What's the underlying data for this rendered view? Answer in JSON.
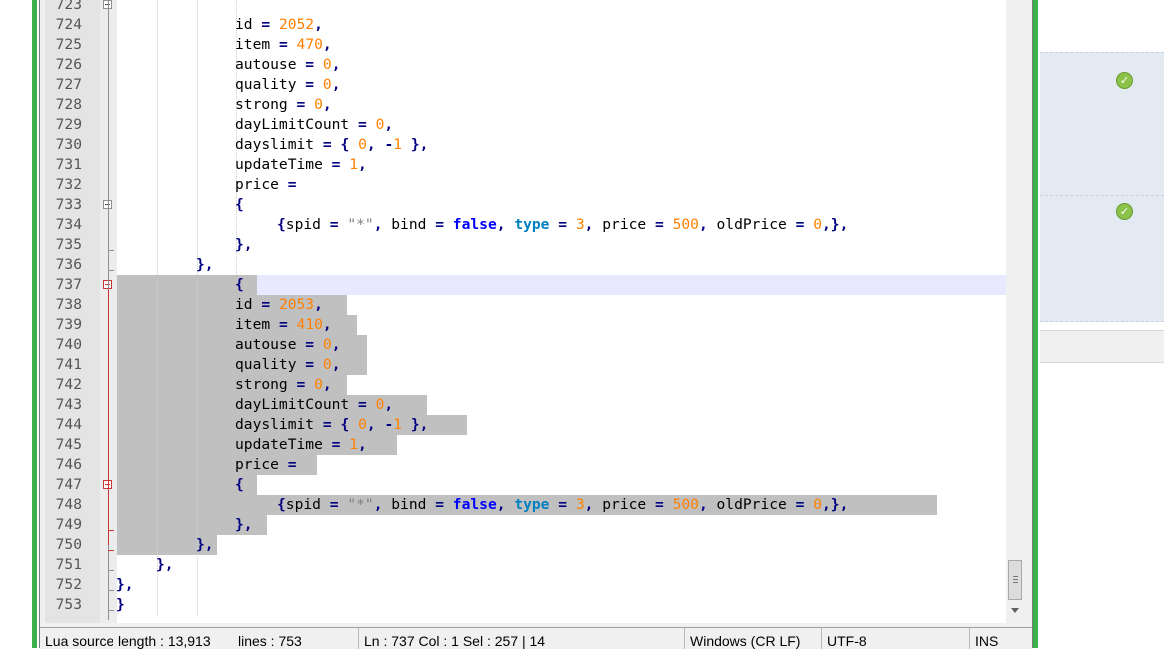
{
  "editor": {
    "lines": [
      {
        "n": "723",
        "parts": []
      },
      {
        "n": "724",
        "parts": [
          [
            "id ",
            ""
          ],
          [
            "=",
            "op"
          ],
          [
            " ",
            ""
          ],
          [
            "2052",
            "num"
          ],
          [
            ",",
            "op"
          ]
        ]
      },
      {
        "n": "725",
        "parts": [
          [
            "item ",
            ""
          ],
          [
            "=",
            "op"
          ],
          [
            " ",
            ""
          ],
          [
            "470",
            "num"
          ],
          [
            ",",
            "op"
          ]
        ]
      },
      {
        "n": "726",
        "parts": [
          [
            "autouse ",
            ""
          ],
          [
            "=",
            "op"
          ],
          [
            " ",
            ""
          ],
          [
            "0",
            "num"
          ],
          [
            ",",
            "op"
          ]
        ]
      },
      {
        "n": "727",
        "parts": [
          [
            "quality ",
            ""
          ],
          [
            "=",
            "op"
          ],
          [
            " ",
            ""
          ],
          [
            "0",
            "num"
          ],
          [
            ",",
            "op"
          ]
        ]
      },
      {
        "n": "728",
        "parts": [
          [
            "strong ",
            ""
          ],
          [
            "=",
            "op"
          ],
          [
            " ",
            ""
          ],
          [
            "0",
            "num"
          ],
          [
            ",",
            "op"
          ]
        ]
      },
      {
        "n": "729",
        "parts": [
          [
            "dayLimitCount ",
            ""
          ],
          [
            "=",
            "op"
          ],
          [
            " ",
            ""
          ],
          [
            "0",
            "num"
          ],
          [
            ",",
            "op"
          ]
        ]
      },
      {
        "n": "730",
        "parts": [
          [
            "dayslimit ",
            ""
          ],
          [
            "=",
            "op"
          ],
          [
            " ",
            ""
          ],
          [
            "{",
            "op"
          ],
          [
            " ",
            ""
          ],
          [
            "0",
            "num"
          ],
          [
            ",",
            "op"
          ],
          [
            " ",
            ""
          ],
          [
            "-",
            "op"
          ],
          [
            "1",
            "num"
          ],
          [
            " ",
            ""
          ],
          [
            "},",
            "op"
          ]
        ]
      },
      {
        "n": "731",
        "parts": [
          [
            "updateTime ",
            ""
          ],
          [
            "=",
            "op"
          ],
          [
            " ",
            ""
          ],
          [
            "1",
            "num"
          ],
          [
            ",",
            "op"
          ]
        ]
      },
      {
        "n": "732",
        "parts": [
          [
            "price ",
            ""
          ],
          [
            "=",
            "op"
          ]
        ]
      },
      {
        "n": "733",
        "parts": [
          [
            "{",
            "op"
          ]
        ]
      },
      {
        "n": "734",
        "parts": [
          [
            "{",
            "op"
          ],
          [
            "spid ",
            ""
          ],
          [
            "=",
            "op"
          ],
          [
            " ",
            ""
          ],
          [
            "\"*\"",
            "str"
          ],
          [
            ",",
            "op"
          ],
          [
            " bind ",
            ""
          ],
          [
            "=",
            "op"
          ],
          [
            " ",
            ""
          ],
          [
            "false",
            "kw"
          ],
          [
            ",",
            "op"
          ],
          [
            " ",
            ""
          ],
          [
            "type",
            "kw2"
          ],
          [
            " ",
            ""
          ],
          [
            "=",
            "op"
          ],
          [
            " ",
            ""
          ],
          [
            "3",
            "num"
          ],
          [
            ",",
            "op"
          ],
          [
            " price ",
            ""
          ],
          [
            "=",
            "op"
          ],
          [
            " ",
            ""
          ],
          [
            "500",
            "num"
          ],
          [
            ",",
            "op"
          ],
          [
            " oldPrice ",
            ""
          ],
          [
            "=",
            "op"
          ],
          [
            " ",
            ""
          ],
          [
            "0",
            "num"
          ],
          [
            ",},",
            "op"
          ]
        ]
      },
      {
        "n": "735",
        "parts": [
          [
            "},",
            "op"
          ]
        ]
      },
      {
        "n": "736",
        "parts": [
          [
            "},",
            "op"
          ]
        ]
      },
      {
        "n": "737",
        "parts": [
          [
            "{",
            "op"
          ]
        ]
      },
      {
        "n": "738",
        "parts": [
          [
            "id ",
            ""
          ],
          [
            "=",
            "op"
          ],
          [
            " ",
            ""
          ],
          [
            "2053",
            "num"
          ],
          [
            ",",
            "op"
          ]
        ]
      },
      {
        "n": "739",
        "parts": [
          [
            "item ",
            ""
          ],
          [
            "=",
            "op"
          ],
          [
            " ",
            ""
          ],
          [
            "410",
            "num"
          ],
          [
            ",",
            "op"
          ]
        ]
      },
      {
        "n": "740",
        "parts": [
          [
            "autouse ",
            ""
          ],
          [
            "=",
            "op"
          ],
          [
            " ",
            ""
          ],
          [
            "0",
            "num"
          ],
          [
            ",",
            "op"
          ]
        ]
      },
      {
        "n": "741",
        "parts": [
          [
            "quality ",
            ""
          ],
          [
            "=",
            "op"
          ],
          [
            " ",
            ""
          ],
          [
            "0",
            "num"
          ],
          [
            ",",
            "op"
          ]
        ]
      },
      {
        "n": "742",
        "parts": [
          [
            "strong ",
            ""
          ],
          [
            "=",
            "op"
          ],
          [
            " ",
            ""
          ],
          [
            "0",
            "num"
          ],
          [
            ",",
            "op"
          ]
        ]
      },
      {
        "n": "743",
        "parts": [
          [
            "dayLimitCount ",
            ""
          ],
          [
            "=",
            "op"
          ],
          [
            " ",
            ""
          ],
          [
            "0",
            "num"
          ],
          [
            ",",
            "op"
          ]
        ]
      },
      {
        "n": "744",
        "parts": [
          [
            "dayslimit ",
            ""
          ],
          [
            "=",
            "op"
          ],
          [
            " ",
            ""
          ],
          [
            "{",
            "op"
          ],
          [
            " ",
            ""
          ],
          [
            "0",
            "num"
          ],
          [
            ",",
            "op"
          ],
          [
            " ",
            ""
          ],
          [
            "-",
            "op"
          ],
          [
            "1",
            "num"
          ],
          [
            " ",
            ""
          ],
          [
            "},",
            "op"
          ]
        ]
      },
      {
        "n": "745",
        "parts": [
          [
            "updateTime ",
            ""
          ],
          [
            "=",
            "op"
          ],
          [
            " ",
            ""
          ],
          [
            "1",
            "num"
          ],
          [
            ",",
            "op"
          ]
        ]
      },
      {
        "n": "746",
        "parts": [
          [
            "price ",
            ""
          ],
          [
            "=",
            "op"
          ]
        ]
      },
      {
        "n": "747",
        "parts": [
          [
            "{",
            "op"
          ]
        ]
      },
      {
        "n": "748",
        "parts": [
          [
            "{",
            "op"
          ],
          [
            "spid ",
            ""
          ],
          [
            "=",
            "op"
          ],
          [
            " ",
            ""
          ],
          [
            "\"*\"",
            "str"
          ],
          [
            ",",
            "op"
          ],
          [
            " bind ",
            ""
          ],
          [
            "=",
            "op"
          ],
          [
            " ",
            ""
          ],
          [
            "false",
            "kw"
          ],
          [
            ",",
            "op"
          ],
          [
            " ",
            ""
          ],
          [
            "type",
            "kw2"
          ],
          [
            " ",
            ""
          ],
          [
            "=",
            "op"
          ],
          [
            " ",
            ""
          ],
          [
            "3",
            "num"
          ],
          [
            ",",
            "op"
          ],
          [
            " price ",
            ""
          ],
          [
            "=",
            "op"
          ],
          [
            " ",
            ""
          ],
          [
            "500",
            "num"
          ],
          [
            ",",
            "op"
          ],
          [
            " oldPrice ",
            ""
          ],
          [
            "=",
            "op"
          ],
          [
            " ",
            ""
          ],
          [
            "0",
            "num"
          ],
          [
            ",},",
            "op"
          ]
        ]
      },
      {
        "n": "749",
        "parts": [
          [
            "},",
            "op"
          ]
        ]
      },
      {
        "n": "750",
        "parts": [
          [
            "},",
            "op"
          ]
        ]
      },
      {
        "n": "751",
        "parts": [
          [
            "},",
            "op"
          ]
        ]
      },
      {
        "n": "752",
        "parts": [
          [
            "},",
            "op"
          ]
        ]
      },
      {
        "n": "753",
        "parts": [
          [
            "}",
            "op"
          ]
        ]
      }
    ]
  },
  "statusbar": {
    "lexer": "Lua source file",
    "length": "length : 13,913",
    "lines": "lines : 753",
    "position": "Ln : 737    Col : 1    Sel : 257 | 14",
    "eol": "Windows (CR LF)",
    "encoding": "UTF-8",
    "mode": "INS"
  },
  "right_panel": {
    "status_icons": [
      "check-circle-icon",
      "check-circle-icon"
    ],
    "accent_color": "#3cb34a"
  }
}
